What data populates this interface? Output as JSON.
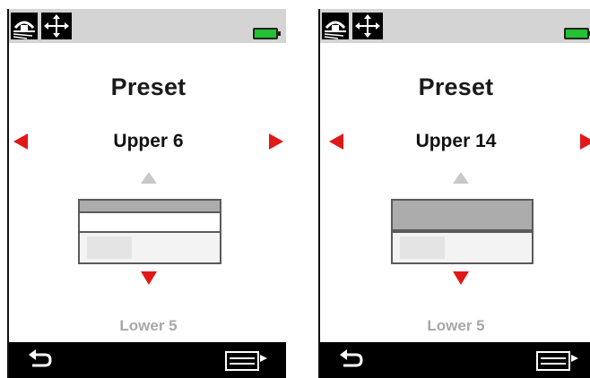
{
  "screens": [
    {
      "title": "Preset",
      "upper_value": "Upper 6",
      "lower_value": "Lower 5",
      "upper_level_fraction": 0.17,
      "lower_level_fraction": 0.52
    },
    {
      "title": "Preset",
      "upper_value": "Upper 14",
      "lower_value": "Lower 5",
      "upper_level_fraction": 0.47,
      "lower_level_fraction": 0.52
    }
  ],
  "colors": {
    "accent_red": "#e01818",
    "battery_green": "#22c233",
    "topbar_gray": "#d4d4d4",
    "disabled_gray": "#a8a8a8"
  },
  "icons": {
    "home": "home-ground-icon",
    "move": "move-arrows-icon",
    "battery": "battery-icon",
    "back": "back-arrow-icon",
    "menu": "menu-exit-icon",
    "prev": "left-arrow-icon",
    "next": "right-arrow-icon",
    "up": "up-triangle-icon",
    "down": "down-triangle-icon"
  }
}
